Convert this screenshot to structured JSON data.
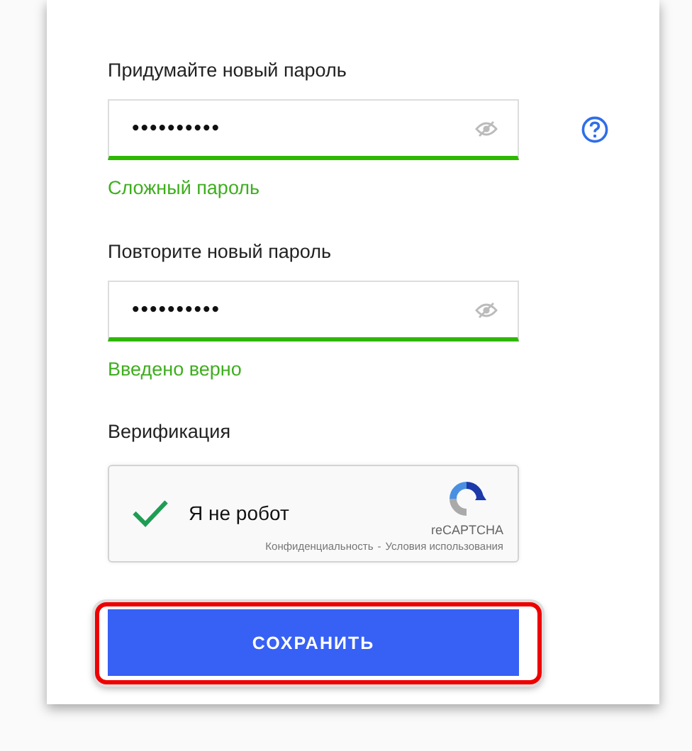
{
  "form": {
    "fields": [
      {
        "label": "Придумайте новый пароль",
        "value": "••••••••••",
        "help": true,
        "status": {
          "text": "Сложный пароль",
          "valid": true
        }
      },
      {
        "label": "Повторите новый пароль",
        "value": "••••••••••",
        "help": false,
        "status": {
          "text": "Введено верно",
          "valid": true
        }
      }
    ],
    "verification": {
      "label": "Верификация",
      "captcha": {
        "text": "Я не робот",
        "checked": true,
        "brand": "reCAPTCHA",
        "privacy": "Конфиденциальность",
        "separator": "-",
        "terms": "Условия использования"
      }
    },
    "save_button": {
      "label": "СОХРАНИТЬ",
      "highlighted": true
    }
  }
}
